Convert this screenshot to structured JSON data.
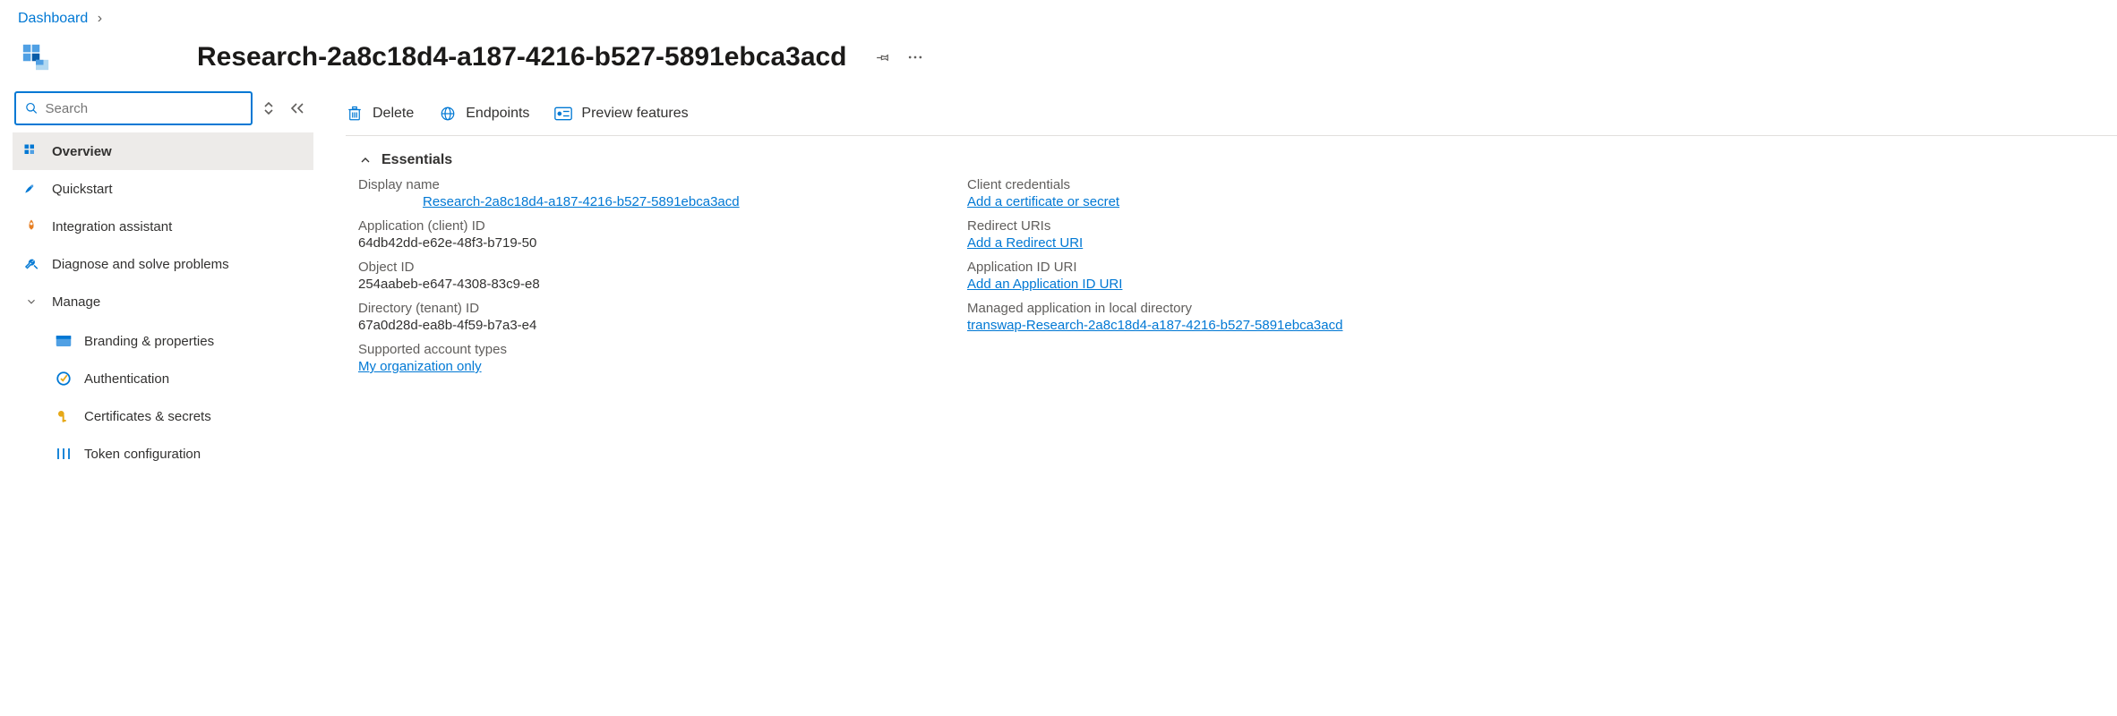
{
  "breadcrumb": {
    "root": "Dashboard"
  },
  "page": {
    "title": "Research-2a8c18d4-a187-4216-b527-5891ebca3acd"
  },
  "search": {
    "placeholder": "Search"
  },
  "sidebar": {
    "items": [
      {
        "label": "Overview"
      },
      {
        "label": "Quickstart"
      },
      {
        "label": "Integration assistant"
      },
      {
        "label": "Diagnose and solve problems"
      }
    ],
    "manage": {
      "label": "Manage",
      "items": [
        {
          "label": "Branding & properties"
        },
        {
          "label": "Authentication"
        },
        {
          "label": "Certificates & secrets"
        },
        {
          "label": "Token configuration"
        }
      ]
    }
  },
  "toolbar": {
    "delete": "Delete",
    "endpoints": "Endpoints",
    "preview": "Preview features"
  },
  "essentials": {
    "header": "Essentials",
    "left": {
      "display_name_label": "Display name",
      "display_name_value": " Research-2a8c18d4-a187-4216-b527-5891ebca3acd",
      "app_id_label": "Application (client) ID",
      "app_id_value": "64db42dd-e62e-48f3-b719-50",
      "object_id_label": "Object ID",
      "object_id_value": "254aabeb-e647-4308-83c9-e8",
      "tenant_id_label": "Directory (tenant) ID",
      "tenant_id_value": "67a0d28d-ea8b-4f59-b7a3-e4",
      "account_types_label": "Supported account types",
      "account_types_value": "My organization only"
    },
    "right": {
      "client_creds_label": "Client credentials",
      "client_creds_value": "Add a certificate or secret",
      "redirect_label": "Redirect URIs",
      "redirect_value": "Add a Redirect URI",
      "app_id_uri_label": "Application ID URI",
      "app_id_uri_value": "Add an Application ID URI",
      "managed_app_label": "Managed application in local directory",
      "managed_app_value": "transwap-Research-2a8c18d4-a187-4216-b527-5891ebca3acd"
    }
  }
}
